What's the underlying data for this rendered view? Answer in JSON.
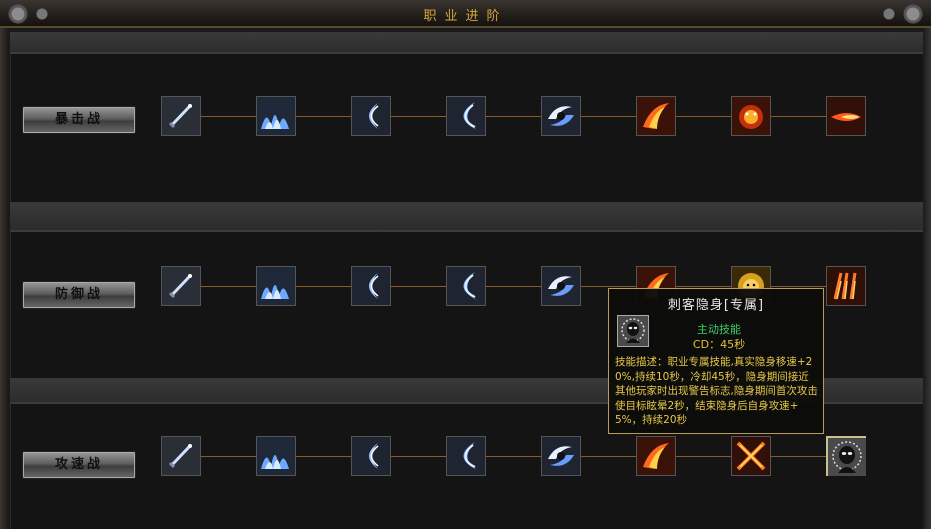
{
  "window": {
    "title": "职业进阶"
  },
  "classes": [
    {
      "label": "暴击战"
    },
    {
      "label": "防御战"
    },
    {
      "label": "攻速战"
    }
  ],
  "tooltip": {
    "title": "刺客隐身[专属]",
    "type": "主动技能",
    "cooldown": "CD：45秒",
    "description": "技能描述：职业专属技能,真实隐身移速+20%,持续10秒，冷却45秒，隐身期间接近其他玩家时出现警告标志,隐身期间首次攻击使目标眩晕2秒，结束隐身后自身攻速+5%，持续20秒"
  },
  "icons": {
    "row1": [
      "sword-icon",
      "ice-wave-icon",
      "crescent-slash-icon",
      "moon-slash-icon",
      "spin-slash-icon",
      "fire-slash-icon",
      "fire-beast-icon",
      "fire-burst-icon"
    ],
    "row2": [
      "sword-icon",
      "ice-wave-icon",
      "crescent-slash-icon",
      "moon-slash-icon",
      "spin-slash-icon",
      "fire-slash-icon",
      "lion-head-icon",
      "fire-claw-icon"
    ],
    "row3": [
      "sword-icon",
      "ice-wave-icon",
      "crescent-slash-icon",
      "moon-slash-icon",
      "spin-slash-icon",
      "fire-slash-icon",
      "crossed-blades-icon",
      "assassin-stealth-icon"
    ]
  },
  "colors": {
    "title": "#d9a53a",
    "link": "#8a5a2a",
    "tooltip_border": "#b89a5a",
    "skill_type": "#3ed06a",
    "description": "#e8c84a"
  }
}
